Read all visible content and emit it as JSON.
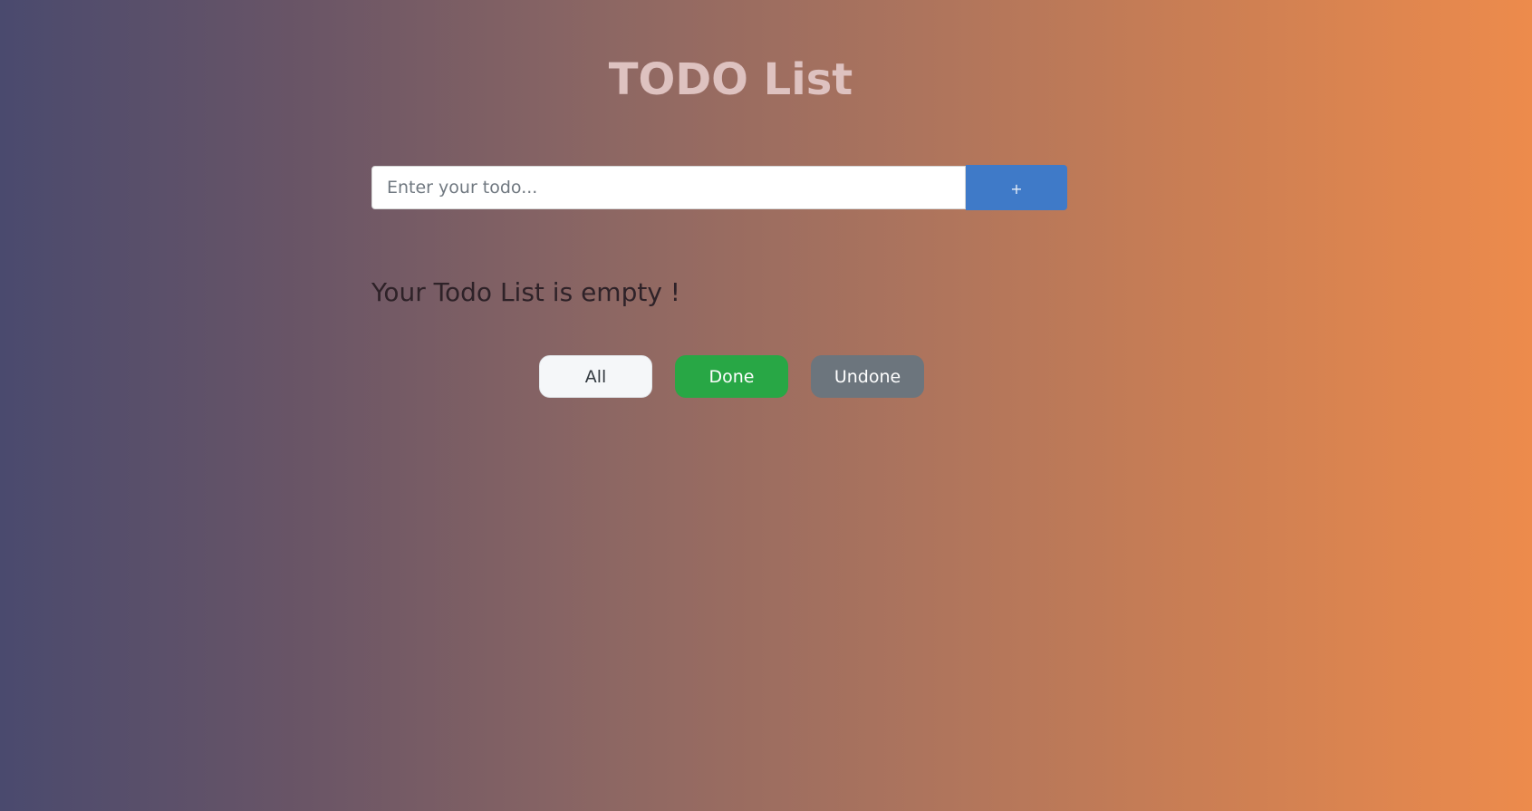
{
  "header": {
    "title": "TODO List"
  },
  "form": {
    "input_value": "",
    "input_placeholder": "Enter your todo...",
    "add_label": "+"
  },
  "list": {
    "empty_message": "Your Todo List is empty !"
  },
  "filters": {
    "all_label": "All",
    "done_label": "Done",
    "undone_label": "Undone"
  },
  "colors": {
    "add_button": "#3f7ac8",
    "done_button": "#28a745",
    "undone_button": "#6c757d",
    "all_button": "#f5f7f9",
    "gradient_start": "#4a4a6e",
    "gradient_end": "#ed8b4c"
  }
}
